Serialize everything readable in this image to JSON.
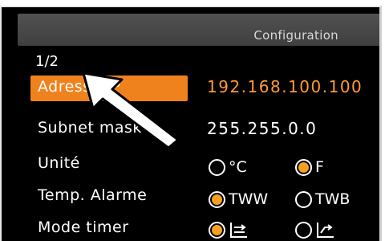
{
  "header": {
    "title": "Configuration"
  },
  "page_indicator": "1/2",
  "rows": {
    "ip": {
      "label": "Adresse IP",
      "value": "192.168.100.100"
    },
    "subnet": {
      "label": "Subnet mask",
      "value": "255.255.0.0"
    },
    "unit": {
      "label": "Unité",
      "option_c": "°C",
      "option_f": "F",
      "selected": "F"
    },
    "alarm": {
      "label": "Temp. Alarme",
      "option_tww": "TWW",
      "option_twb": "TWB",
      "selected": "TWW"
    },
    "timer": {
      "label": "Mode timer",
      "selected": "first"
    }
  },
  "colors": {
    "accent": "#f0821e",
    "background": "#000000",
    "text": "#ffffff",
    "header": "#4a4a4a"
  },
  "icons": [
    "pointer-arrow-icon",
    "timer-mode-icon"
  ]
}
